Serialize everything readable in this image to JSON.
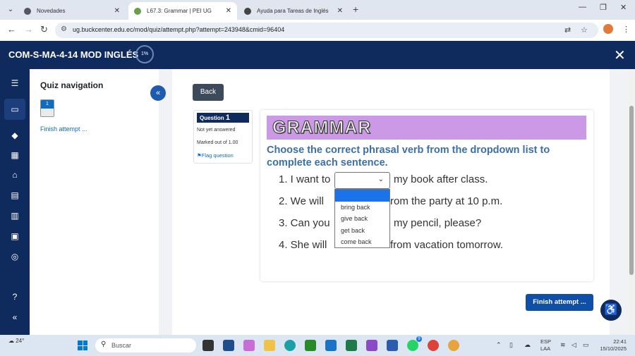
{
  "browser": {
    "tabs": [
      {
        "label": "Novedades"
      },
      {
        "label": "L67.3: Grammar | PEI UG"
      },
      {
        "label": "Ayuda para Tareas de Inglés"
      }
    ],
    "url": "ug.buckcenter.edu.ec/mod/quiz/attempt.php?attempt=243948&cmid=96404"
  },
  "header": {
    "course_title": "COM-S-MA-4-14 MOD INGLÉS",
    "progress": "1%"
  },
  "quiz_nav": {
    "title": "Quiz navigation",
    "question_number": "1",
    "finish_link": "Finish attempt ..."
  },
  "main": {
    "back_label": "Back",
    "question_info": {
      "prefix": "Question",
      "number": "1",
      "status": "Not yet answered",
      "marked": "Marked out of 1.00",
      "flag": "Flag question"
    },
    "banner": "GRAMMAR",
    "instruction": "Choose the correct phrasal verb from the dropdown list to complete each sentence.",
    "sentences": [
      {
        "before": "1. I want to",
        "after": "my book after class."
      },
      {
        "before": "2. We will",
        "after": "rom the party at 10 p.m."
      },
      {
        "before": "3. Can you",
        "after": "my pencil, please?"
      },
      {
        "before": "4. She will",
        "after": "from vacation tomorrow."
      }
    ],
    "dropdown_options": [
      "",
      "bring back",
      "give back",
      "get back",
      "come back"
    ],
    "finish_button": "Finish attempt ..."
  },
  "taskbar": {
    "weather": "24°",
    "search_placeholder": "Buscar",
    "lang_line1": "ESP",
    "lang_line2": "LAA",
    "time": "22:41",
    "date": "15/10/2025",
    "notification_count": "9"
  },
  "colors": {
    "header_bg": "#0f2a5c",
    "banner_bg": "#cc99e6",
    "instruction": "#3c6fa6",
    "link": "#0f6cbf"
  }
}
